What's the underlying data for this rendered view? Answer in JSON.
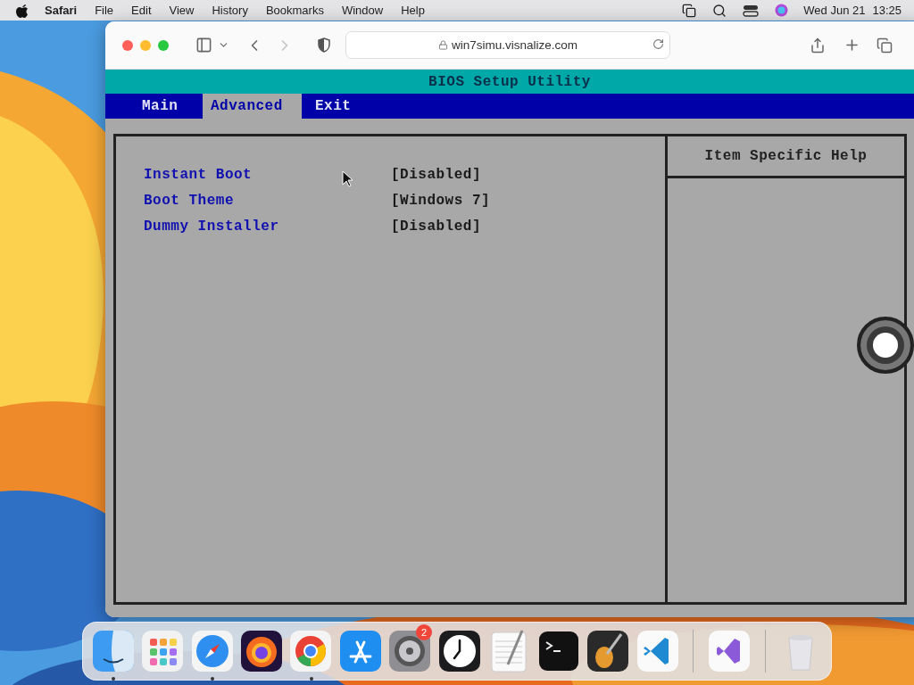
{
  "menubar": {
    "app": "Safari",
    "menus": [
      "File",
      "Edit",
      "View",
      "History",
      "Bookmarks",
      "Window",
      "Help"
    ],
    "date": "Wed Jun 21",
    "time": "13:25"
  },
  "browser": {
    "address": "win7simu.visnalize.com",
    "forward_disabled": true
  },
  "bios": {
    "title": "BIOS Setup Utility",
    "tabs": [
      {
        "label": "Main",
        "selected": false
      },
      {
        "label": "Advanced",
        "selected": true
      },
      {
        "label": "Exit",
        "selected": false
      }
    ],
    "settings": [
      {
        "label": "Instant Boot",
        "value": "[Disabled]"
      },
      {
        "label": "Boot Theme",
        "value": "[Windows 7]"
      },
      {
        "label": "Dummy Installer",
        "value": "[Disabled]"
      }
    ],
    "help_title": "Item Specific Help"
  },
  "dock": {
    "sections": [
      [
        {
          "kind": "finder",
          "running": true
        },
        {
          "kind": "launchpad",
          "running": false
        },
        {
          "kind": "safari",
          "running": true
        },
        {
          "kind": "firefox",
          "running": false
        },
        {
          "kind": "chrome",
          "running": true
        },
        {
          "kind": "appstore",
          "running": false
        },
        {
          "kind": "settings",
          "running": false,
          "badge": "2"
        },
        {
          "kind": "clock",
          "running": false
        },
        {
          "kind": "textedit",
          "running": false
        },
        {
          "kind": "terminal",
          "running": false
        },
        {
          "kind": "guitar",
          "running": false
        },
        {
          "kind": "vscode",
          "running": false
        }
      ],
      [
        {
          "kind": "visualstudio",
          "running": false
        }
      ],
      [
        {
          "kind": "trash",
          "running": false
        }
      ]
    ]
  }
}
